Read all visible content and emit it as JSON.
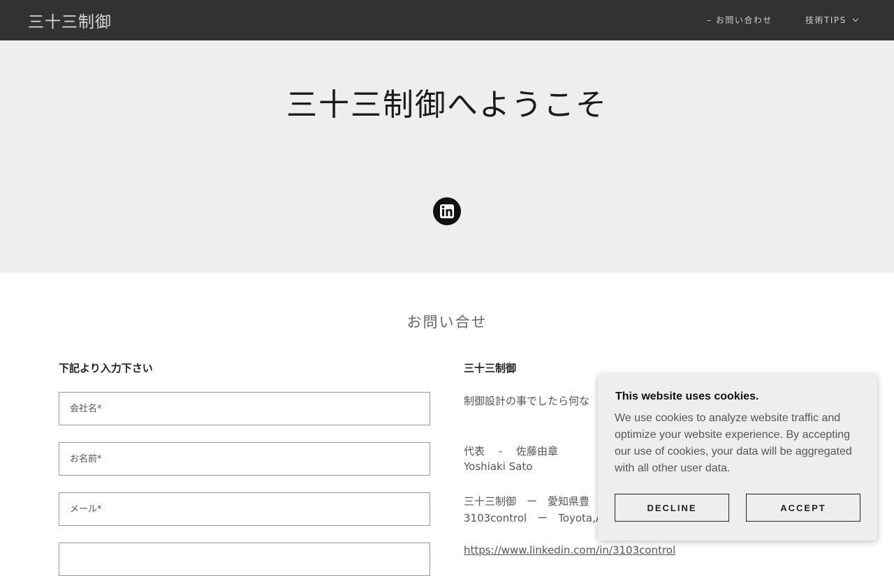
{
  "header": {
    "logo": "三十三制御",
    "nav": {
      "contact_label": "– お問い合わせ",
      "tips_label": "技術TIPS"
    }
  },
  "hero": {
    "title": "三十三制御へようこそ",
    "social_icon": "linkedin-icon"
  },
  "contact": {
    "section_title": "お問い合せ",
    "form": {
      "heading": "下記より入力下さい",
      "fields": {
        "company_placeholder": "会社名*",
        "name_placeholder": "お名前*",
        "email_placeholder": "メール*"
      }
    },
    "info": {
      "name": "三十三制御",
      "tagline": "制御設計の事でしたら何な",
      "rep_jp": "代表　 -　 佐藤由章",
      "rep_en": "Yoshiaki Sato",
      "address_jp": "三十三制御　ー　愛知県豊",
      "address_en": "3103control　ー　Toyota,A",
      "link": "https://www.linkedin.com/in/3103control"
    }
  },
  "cookie_banner": {
    "title": "This website uses cookies.",
    "body": "We use cookies to analyze website traffic and optimize your website experience. By accepting our use of cookies, your data will be aggregated with all other user data.",
    "decline_label": "DECLINE",
    "accept_label": "ACCEPT"
  }
}
